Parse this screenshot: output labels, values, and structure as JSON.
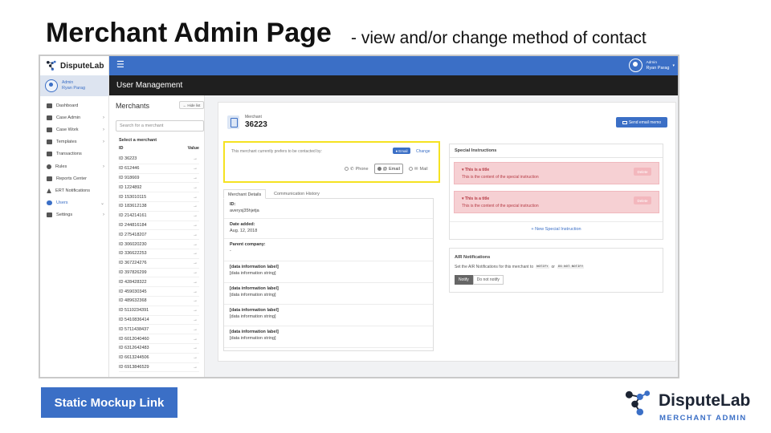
{
  "slide": {
    "title": "Merchant Admin Page",
    "subtitle": "-  view and/or change method of contact",
    "mockup_link": "Static Mockup Link",
    "brand_name": "DisputeLab",
    "brand_tagline": "MERCHANT ADMIN"
  },
  "app": {
    "brand": "DisputeLab",
    "user": {
      "role": "Admin",
      "name": "Ryan Parag"
    },
    "section_title": "User Management",
    "accent_color": "#3b6fc6",
    "nav": [
      {
        "label": "Dashboard",
        "icon": "home-icon",
        "chevron": ""
      },
      {
        "label": "Case Admin",
        "icon": "briefcase-icon",
        "chevron": "›"
      },
      {
        "label": "Case Work",
        "icon": "check-square-icon",
        "chevron": "›"
      },
      {
        "label": "Templates",
        "icon": "envelope-icon",
        "chevron": "›"
      },
      {
        "label": "Transactions",
        "icon": "card-icon",
        "chevron": ""
      },
      {
        "label": "Rules",
        "icon": "gear-icon",
        "chevron": "›"
      },
      {
        "label": "Reports Center",
        "icon": "document-icon",
        "chevron": ""
      },
      {
        "label": "ERT Notifications",
        "icon": "warning-icon",
        "chevron": ""
      },
      {
        "label": "Users",
        "icon": "users-icon",
        "chevron": "⌄"
      },
      {
        "label": "Settings",
        "icon": "sliders-icon",
        "chevron": "›"
      }
    ]
  },
  "merchants": {
    "title": "Merchants",
    "hide_label": "← Hide list",
    "search_placeholder": "Search for a merchant",
    "list_label": "Select a merchant",
    "col_id": "ID",
    "col_value": "Value",
    "rows": [
      "ID 36223",
      "ID 612446",
      "ID 918669",
      "ID 1224892",
      "ID 153010115",
      "ID 183612138",
      "ID 214214161",
      "ID 244816184",
      "ID 275418207",
      "ID 306020230",
      "ID 336622253",
      "ID 367224276",
      "ID 397826299",
      "ID 428428322",
      "ID 459030345",
      "ID 489632368",
      "ID 5110234391",
      "ID 5410836414",
      "ID 5711438437",
      "ID 6012040460",
      "ID 6312642483",
      "ID 6613244506",
      "ID 6913846529"
    ],
    "arrow": "→"
  },
  "merchant": {
    "label": "Merchant",
    "id": "36223",
    "send_email": "Send email memo",
    "contact": {
      "prompt": "This merchant currently prefers to be contacted by:",
      "current": "Email",
      "change": "Change",
      "options": [
        "Phone",
        "Email",
        "Mail"
      ]
    },
    "tabs": [
      "Merchant Details",
      "Communication History"
    ],
    "details": [
      {
        "label": "ID:",
        "value": "averysj35hjetja"
      },
      {
        "label": "Date added:",
        "value": "Aug. 12, 2018"
      },
      {
        "label": "Parent company:",
        "value": "-"
      },
      {
        "label": "[data information label]",
        "value": "[data information string]"
      },
      {
        "label": "[data information label]",
        "value": "[data information string]"
      },
      {
        "label": "[data information label]",
        "value": "[data information string]"
      },
      {
        "label": "[data information label]",
        "value": "[data information string]"
      }
    ]
  },
  "special": {
    "title": "Special Instructions",
    "alerts": [
      {
        "title": "This is a title",
        "text": "This is the content of the special instruction",
        "button": "Delete"
      },
      {
        "title": "This is a title",
        "text": "This is the content of the special instruction",
        "button": "Delete"
      }
    ],
    "new_label": "New Special Instruction"
  },
  "air": {
    "title": "AIR Notifications",
    "text_before": "Set the AIR Notifications for this merchant to",
    "code_notify": "NOTIFY",
    "text_or": "or",
    "code_do_not": "DO NOT NOTIFY",
    "btn_notify": "Notify",
    "btn_do_not": "Do not notify"
  }
}
